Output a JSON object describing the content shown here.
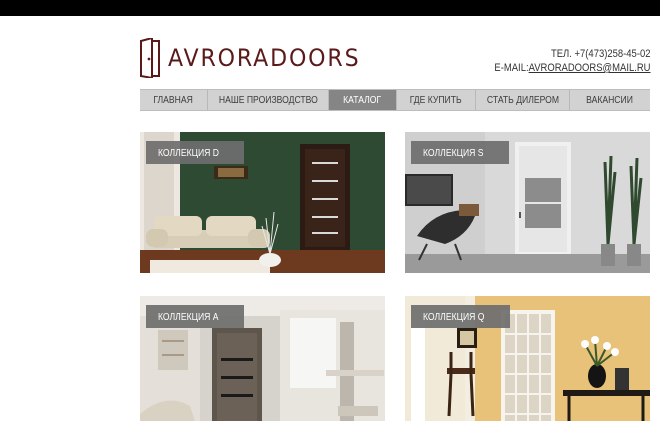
{
  "header": {
    "logo_text": "AVRORADOORS",
    "phone": "ТЕЛ. +7(473)258-45-02",
    "email_prefix": "E-MAIL:",
    "email": "AVRORADOORS@MAIL.RU"
  },
  "nav": {
    "items": [
      {
        "label": "ГЛАВНАЯ"
      },
      {
        "label": "НАШЕ ПРОИЗВОДСТВО"
      },
      {
        "label": "КАТАЛОГ"
      },
      {
        "label": "ГДЕ КУПИТЬ"
      },
      {
        "label": "СТАТЬ ДИЛЕРОМ"
      },
      {
        "label": "ВАКАНСИИ"
      }
    ],
    "active_index": 2
  },
  "collections": [
    {
      "label": "КОЛЛЕКЦИЯ D"
    },
    {
      "label": "КОЛЛЕКЦИЯ S"
    },
    {
      "label": "КОЛЛЕКЦИЯ A"
    },
    {
      "label": "КОЛЛЕКЦИЯ Q"
    }
  ],
  "colors": {
    "brand": "#5a1a1a",
    "nav_bg": "#d2d2d2",
    "nav_active": "#858585",
    "label_bg": "#6e6e6e"
  }
}
